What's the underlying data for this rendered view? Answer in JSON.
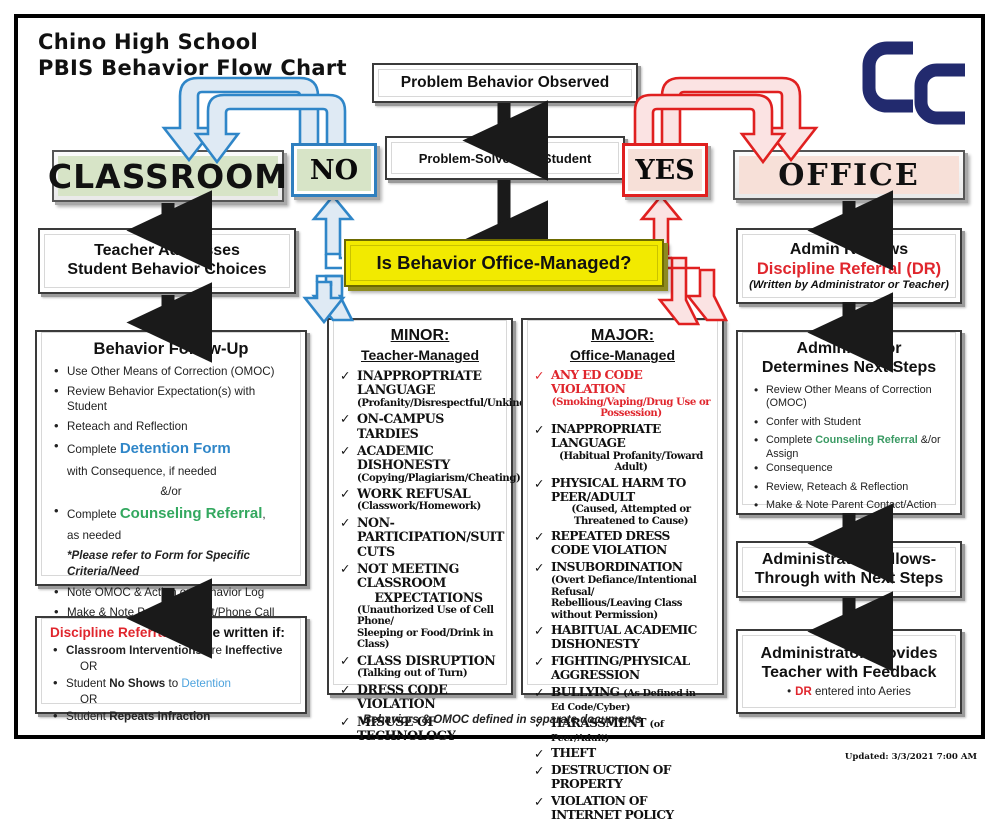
{
  "title": {
    "line1": "Chino High School",
    "line2": "PBIS Behavior Flow Chart"
  },
  "logo": {
    "name": "chino-high-school-cc-logo",
    "color": "#222a6e",
    "text": "CC"
  },
  "flow": {
    "problem_observed": "Problem Behavior Observed",
    "problem_solve": "Problem-Solve with Student",
    "decision": "Is Behavior Office-Managed?",
    "no_label": "NO",
    "yes_label": "YES",
    "classroom_label": "CLASSROOM",
    "office_label": "OFFICE"
  },
  "colors": {
    "no_path": "#2f86c8",
    "yes_path": "#e02020",
    "classroom_fill": "#d7e4c7",
    "office_fill": "#f7e0d8",
    "decision_fill": "#f2ea00",
    "red_accent": "#e0262d",
    "green_accent": "#33a85f",
    "blue_accent": "#2f86c8"
  },
  "classroom_side": {
    "teacher_box": {
      "line1": "Teacher Addresses",
      "line2": "Student Behavior Choices"
    },
    "followup": {
      "heading": "Behavior Follow-Up",
      "items": [
        {
          "text": "Use Other Means of Correction (OMOC)"
        },
        {
          "text": "Review Behavior Expectation(s) with Student"
        },
        {
          "text": "Reteach and Reflection"
        },
        {
          "text_pre": "Complete ",
          "accent": "Detention Form",
          "accent_color": "blue",
          "text_post": ""
        },
        {
          "cont": "with Consequence, if needed"
        },
        {
          "center": "&/or"
        },
        {
          "text_pre": "Complete ",
          "accent": "Counseling Referral",
          "accent_color": "green",
          "text_post": ","
        },
        {
          "cont": "as needed"
        },
        {
          "note": "*Please refer to Form for Specific Criteria/Need"
        },
        {
          "text": "Note OMOC & Action on Behavior Log"
        },
        {
          "text": "Make & Note Parent Contact/Phone Call"
        }
      ]
    },
    "referral": {
      "heading_accent": "Discipline Referral",
      "heading_rest": " may be written if:",
      "items": [
        {
          "bold1": "Classroom Interventions",
          "mid": " are ",
          "bold2": "Ineffective"
        },
        {
          "or": "OR"
        },
        {
          "pre": "Student ",
          "bold1": "No Shows",
          "mid": " to ",
          "link": "Detention"
        },
        {
          "or": "OR"
        },
        {
          "pre": "Student ",
          "bold1": "Repeats Infraction"
        }
      ]
    }
  },
  "minor_column": {
    "heading": "MINOR:",
    "subheading": "Teacher-Managed",
    "items": [
      {
        "main": "INAPPROPTRIATE LANGUAGE"
      },
      {
        "sub": "(Profanity/Disrespectful/Unkind)",
        "center": true
      },
      {
        "main": "ON-CAMPUS TARDIES"
      },
      {
        "main": "ACADEMIC DISHONESTY"
      },
      {
        "sub": "(Copying/Plagiarism/Cheating)",
        "center": true
      },
      {
        "main": "WORK REFUSAL"
      },
      {
        "sub": "(Classwork/Homework)"
      },
      {
        "main": "NON-PARTICIPATION/SUIT CUTS"
      },
      {
        "main": "NOT MEETING CLASSROOM"
      },
      {
        "cont": "EXPECTATIONS"
      },
      {
        "sub": "(Unauthorized Use of Cell Phone/"
      },
      {
        "sub": "Sleeping or Food/Drink in Class)"
      },
      {
        "main": "CLASS DISRUPTION"
      },
      {
        "sub": "(Talking out of Turn)"
      },
      {
        "main": "DRESS CODE VIOLATION"
      },
      {
        "main": "MISUSE OF TECHNOLOGY"
      }
    ]
  },
  "major_column": {
    "heading": "MAJOR:",
    "subheading": "Office-Managed",
    "items": [
      {
        "main": "ANY ED CODE VIOLATION",
        "red": true
      },
      {
        "sub": "(Smoking/Vaping/Drug Use or Possession)",
        "red": true,
        "center": true
      },
      {
        "main": "INAPPROPRIATE LANGUAGE"
      },
      {
        "sub": "(Habitual Profanity/Toward Adult)",
        "center": true
      },
      {
        "main": "PHYSICAL HARM TO PEER/ADULT"
      },
      {
        "sub": "(Caused, Attempted or Threatened to Cause)",
        "center": true
      },
      {
        "main": "REPEATED DRESS CODE VIOLATION"
      },
      {
        "main": "INSUBORDINATION"
      },
      {
        "sub": "(Overt Defiance/Intentional Refusal/"
      },
      {
        "sub": "Rebellious/Leaving Class without Permission)"
      },
      {
        "main": "HABITUAL ACADEMIC DISHONESTY"
      },
      {
        "main": "FIGHTING/PHYSICAL AGGRESSION"
      },
      {
        "main": "BULLYING",
        "inline": "(As Defined in Ed Code/Cyber)"
      },
      {
        "main": "HARASSMENT",
        "inline": "(of Peer/Adult)"
      },
      {
        "main": "THEFT"
      },
      {
        "main": "DESTRUCTION OF PROPERTY"
      },
      {
        "main": "VIOLATION OF INTERNET POLICY"
      }
    ]
  },
  "office_side": {
    "admin_reviews": {
      "line1": "Admin Reviews",
      "line2": "Discipline Referral (DR)",
      "line3": "(Written by Administrator or Teacher)"
    },
    "determines": {
      "line1": "Administrator",
      "line2": "Determines Next Steps",
      "items": [
        {
          "text": "Review Other Means of Correction (OMOC)"
        },
        {
          "text": "Confer with Student"
        },
        {
          "pre": "Complete ",
          "accent": "Counseling Referral",
          "post": " &/or Assign"
        },
        {
          "cont": "Consequence"
        },
        {
          "text": "Review, Reteach & Reflection"
        },
        {
          "text": "Make & Note Parent Contact/Action"
        }
      ]
    },
    "follows_through": {
      "line1": "Administrator Follows-",
      "line2": "Through with Next Steps"
    },
    "feedback": {
      "line1": "Administrator Provides",
      "line2": "Teacher with Feedback",
      "bullet_accent": "DR",
      "bullet_rest": " entered into Aeries"
    }
  },
  "footer": {
    "note": "Behaviors & OMOC defined in separate documents",
    "updated": "Updated:  3/3/2021 7:00 AM"
  }
}
